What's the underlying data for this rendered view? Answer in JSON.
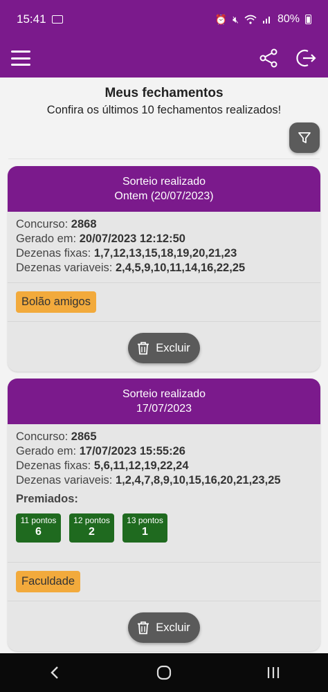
{
  "status_bar": {
    "time": "15:41",
    "battery": "80%"
  },
  "page": {
    "title": "Meus fechamentos",
    "subtitle": "Confira os últimos 10 fechamentos realizados!"
  },
  "labels": {
    "concurso": "Concurso:",
    "gerado": "Gerado em:",
    "fixas": "Dezenas fixas:",
    "variaveis": "Dezenas variaveis:",
    "premiados": "Premiados:",
    "excluir": "Excluir"
  },
  "cards": [
    {
      "header_line1": "Sorteio realizado",
      "header_line2": "Ontem (20/07/2023)",
      "concurso": "2868",
      "gerado": "20/07/2023 12:12:50",
      "fixas": "1,7,12,13,15,18,19,20,21,23",
      "variaveis": "2,4,5,9,10,11,14,16,22,25",
      "tag": "Bolão amigos"
    },
    {
      "header_line1": "Sorteio realizado",
      "header_line2": "17/07/2023",
      "concurso": "2865",
      "gerado": "17/07/2023 15:55:26",
      "fixas": "5,6,11,12,19,22,24",
      "variaveis": "1,2,4,7,8,9,10,15,16,20,21,23,25",
      "prizes": [
        {
          "label": "11 pontos",
          "value": "6"
        },
        {
          "label": "12 pontos",
          "value": "2"
        },
        {
          "label": "13 pontos",
          "value": "1"
        }
      ],
      "tag": "Faculdade"
    }
  ],
  "colors": {
    "brand": "#7b1a8c",
    "prize": "#1f6a1f",
    "tag": "#f2aa3c",
    "button": "#5a5a5a"
  },
  "icons": [
    "menu-icon",
    "share-icon",
    "logout-icon",
    "filter-icon",
    "trash-icon",
    "back-icon",
    "home-icon",
    "recents-icon"
  ]
}
